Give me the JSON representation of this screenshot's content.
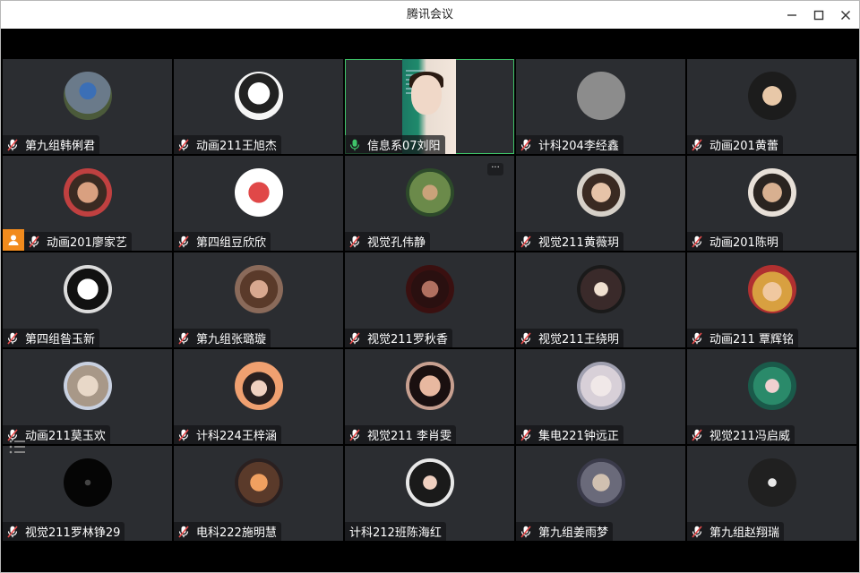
{
  "window": {
    "title": "腾讯会议"
  },
  "colors": {
    "tile_bg": "#2b2d31",
    "active_border": "#3fc46a",
    "mic_muted": "#e84c4c",
    "mic_active": "#3fc46a",
    "host_badge": "#f28b1d"
  },
  "participants": [
    {
      "name": "第九组韩俐君",
      "mic": "muted",
      "avatar": "sign-photo"
    },
    {
      "name": "动画211王旭杰",
      "mic": "muted",
      "avatar": "anime-girl"
    },
    {
      "name": "信息系07刘阳",
      "mic": "active",
      "avatar": "video"
    },
    {
      "name": "计科204李经鑫",
      "mic": "muted",
      "avatar": "gray-circle"
    },
    {
      "name": "动画201黄蕾",
      "mic": "muted",
      "avatar": "portrait-dark"
    },
    {
      "name": "动画201廖家艺",
      "mic": "muted",
      "avatar": "child-photo",
      "host": true
    },
    {
      "name": "第四组豆欣欣",
      "mic": "muted",
      "avatar": "cartoon-pig"
    },
    {
      "name": "视觉孔伟静",
      "mic": "muted",
      "avatar": "outdoor-photo",
      "more": true
    },
    {
      "name": "视觉211黄薇玥",
      "mic": "muted",
      "avatar": "woman-photo"
    },
    {
      "name": "动画201陈明",
      "mic": "muted",
      "avatar": "man-photo"
    },
    {
      "name": "第四组昝玉新",
      "mic": "muted",
      "avatar": "anime-bw"
    },
    {
      "name": "第九组张璐璇",
      "mic": "muted",
      "avatar": "girl-photo"
    },
    {
      "name": "视觉211罗秋香",
      "mic": "muted",
      "avatar": "dark-face"
    },
    {
      "name": "视觉211王绕明",
      "mic": "muted",
      "avatar": "meme-photo"
    },
    {
      "name": "动画211 覃辉铭",
      "mic": "muted",
      "avatar": "luffy"
    },
    {
      "name": "动画211莫玉欢",
      "mic": "muted",
      "avatar": "cat-photo"
    },
    {
      "name": "计科224王梓涵",
      "mic": "muted",
      "avatar": "sunset-girl"
    },
    {
      "name": "视觉211 李肖雯",
      "mic": "muted",
      "avatar": "face-close"
    },
    {
      "name": "集电221钟远正",
      "mic": "muted",
      "avatar": "anime-white-hair"
    },
    {
      "name": "视觉211冯启威",
      "mic": "muted",
      "avatar": "green-anime"
    },
    {
      "name": "视觉211罗林铮29",
      "mic": "muted",
      "avatar": "starfield"
    },
    {
      "name": "电科222施明慧",
      "mic": "muted",
      "avatar": "sunset-photo"
    },
    {
      "name": "计科212班陈海红",
      "mic": "none",
      "avatar": "girl-camera"
    },
    {
      "name": "第九组姜雨梦",
      "mic": "muted",
      "avatar": "fashion-photo"
    },
    {
      "name": "第九组赵翔瑞",
      "mic": "muted",
      "avatar": "dark-abstract"
    }
  ]
}
